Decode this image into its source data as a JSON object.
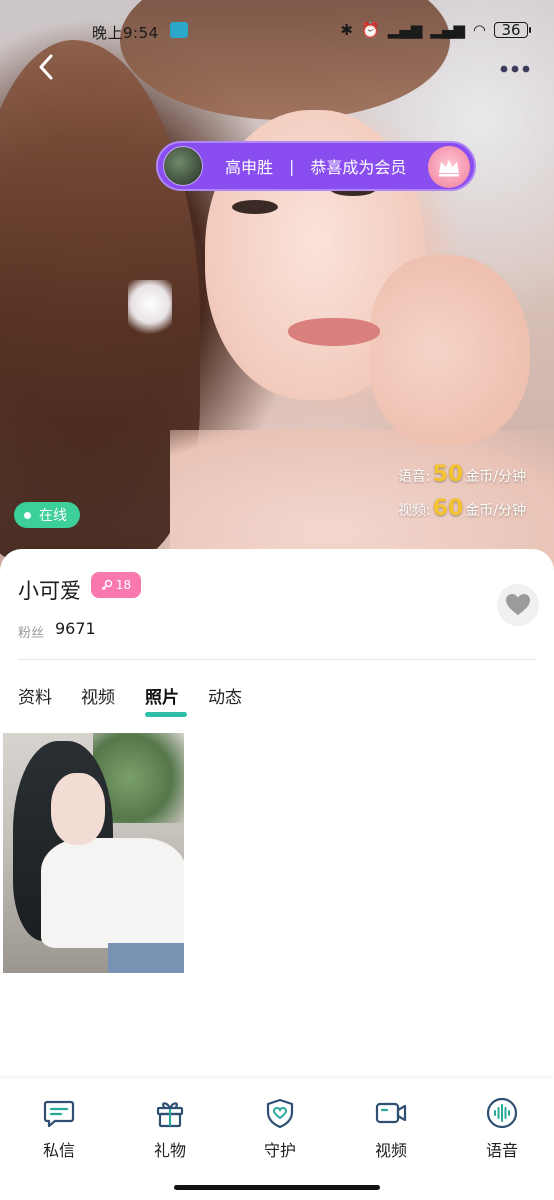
{
  "status_bar": {
    "time": "晚上9:54",
    "battery": "36",
    "icons": [
      "bluetooth-icon",
      "alarm-icon",
      "hd-signal-icon",
      "signal-icon",
      "wifi-icon",
      "battery-icon"
    ]
  },
  "header": {
    "back_icon": "chevron-left-icon",
    "more_icon": "more-dots-icon"
  },
  "notice": {
    "name": "高申胜",
    "separator": "|",
    "text": "恭喜成为会员",
    "icon": "crown-icon",
    "colors": {
      "background": "#8a4ef0",
      "badge": "#f69ab2"
    }
  },
  "pricing": {
    "voice_label": "语音:",
    "voice_value": "50",
    "voice_unit": "金币/分钟",
    "video_label": "视频:",
    "video_value": "60",
    "video_unit": "金币/分钟",
    "accent": "#f5c230"
  },
  "status": {
    "online": "在线",
    "color": "#3ccf9a"
  },
  "profile": {
    "name": "小可爱",
    "level_icon": "female-icon",
    "level": "18",
    "fans_label": "粉丝",
    "fans_count": "9671",
    "favorite_icon": "heart-icon"
  },
  "tabs": {
    "items": [
      "资料",
      "视频",
      "照片",
      "动态"
    ],
    "active": "照片",
    "indicator_color": "#2fbfa8"
  },
  "bottom_nav": {
    "items": [
      {
        "label": "私信",
        "icon": "message-icon"
      },
      {
        "label": "礼物",
        "icon": "gift-icon"
      },
      {
        "label": "守护",
        "icon": "shield-heart-icon"
      },
      {
        "label": "视频",
        "icon": "video-camera-icon"
      },
      {
        "label": "语音",
        "icon": "voice-wave-icon"
      }
    ],
    "icon_color": "#2f4f73"
  }
}
